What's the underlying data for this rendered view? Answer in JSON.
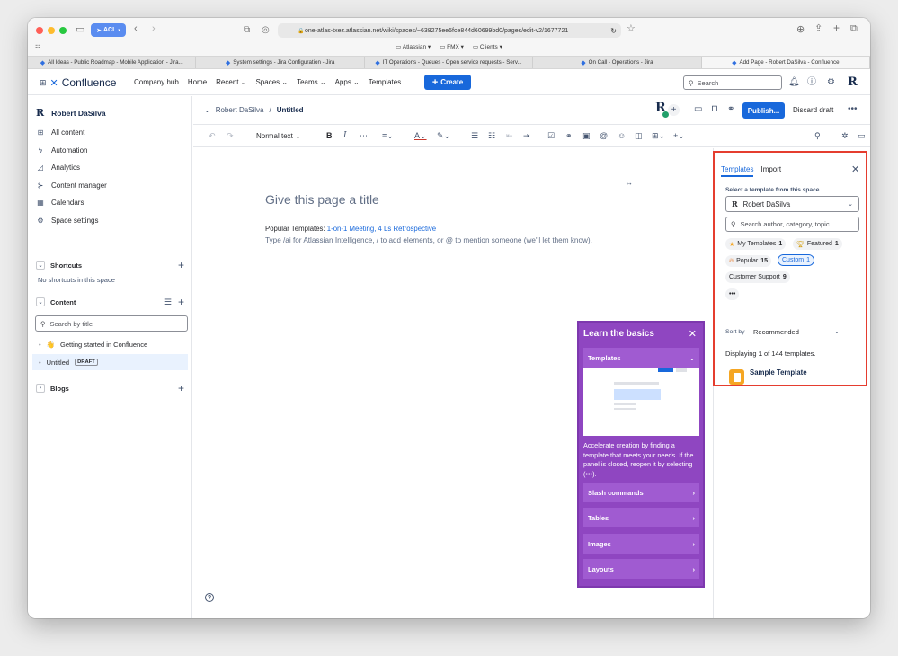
{
  "browser": {
    "acl_label": "ACL",
    "url": "one-atlas-txez.atlassian.net/wiki/spaces/~638275ee5fce844d60699bd0/pages/edit-v2/1677721",
    "bookmarks": [
      "Atlassian",
      "FMX",
      "Clients"
    ],
    "tabs": [
      {
        "label": "All Ideas - Public Roadmap - Mobile Application - Jira..."
      },
      {
        "label": "System settings - Jira Configuration - Jira"
      },
      {
        "label": "IT Operations - Queues - Open service requests - Serv..."
      },
      {
        "label": "On Call - Operations - Jira"
      },
      {
        "label": "Add Page - Robert DaSilva - Confluence"
      }
    ]
  },
  "topnav": {
    "product": "Confluence",
    "items": [
      "Company hub",
      "Home",
      "Recent",
      "Spaces",
      "Teams",
      "Apps",
      "Templates"
    ],
    "create_label": "Create",
    "search_placeholder": "Search",
    "avatar_letter": "R"
  },
  "sidebar": {
    "space_initial": "R",
    "space_name": "Robert DaSilva",
    "items": [
      "All content",
      "Automation",
      "Analytics",
      "Content manager",
      "Calendars",
      "Space settings"
    ],
    "shortcuts_label": "Shortcuts",
    "no_shortcuts": "No shortcuts in this space",
    "content_label": "Content",
    "search_placeholder": "Search by title",
    "tree": [
      {
        "emoji": "👋",
        "label": "Getting started in Confluence"
      },
      {
        "label": "Untitled",
        "badge": "DRAFT"
      }
    ],
    "blogs_label": "Blogs"
  },
  "editor": {
    "breadcrumb_parent": "Robert DaSilva",
    "breadcrumb_current": "Untitled",
    "collaborator_initial": "R",
    "publish_label": "Publish...",
    "discard_label": "Discard draft",
    "text_style": "Normal text",
    "title_placeholder": "Give this page a title",
    "popular_prefix": "Popular Templates: ",
    "popular_links": "1-on-1 Meeting, 4 Ls Retrospective",
    "type_hint": "Type /ai for Atlassian Intelligence, / to add elements, or @ to mention someone (we'll let them know)."
  },
  "learn": {
    "title": "Learn the basics",
    "open_section": "Templates",
    "description": "Accelerate creation by finding a template that meets your needs. If the panel is closed, reopen it by selecting (•••).",
    "sections": [
      "Slash commands",
      "Tables",
      "Images",
      "Layouts"
    ]
  },
  "templates_panel": {
    "tab_templates": "Templates",
    "tab_import": "Import",
    "select_label": "Select a template from this space",
    "space_initial": "R",
    "selected_space": "Robert DaSilva",
    "search_placeholder": "Search author, category, topic",
    "chips": [
      {
        "icon": "star-icon",
        "label": "My Templates",
        "count": "1"
      },
      {
        "icon": "trophy-icon",
        "label": "Featured",
        "count": "1"
      },
      {
        "icon": "fire-icon",
        "label": "Popular",
        "count": "15"
      },
      {
        "label": "Custom",
        "count": "1",
        "selected": true
      },
      {
        "label": "Customer Support",
        "count": "9"
      }
    ],
    "more_label": "•••",
    "sort_label": "Sort by",
    "sort_value": "Recommended",
    "displaying_prefix": "Displaying ",
    "displaying_count": "1",
    "displaying_middle": " of ",
    "displaying_total": "144",
    "displaying_suffix": " templates.",
    "template_name": "Sample Template"
  },
  "colors": {
    "accent": "#1868db",
    "learn_purple": "#8f46c1",
    "highlight": "#e53d2f",
    "template_icon": "#f5a623"
  }
}
